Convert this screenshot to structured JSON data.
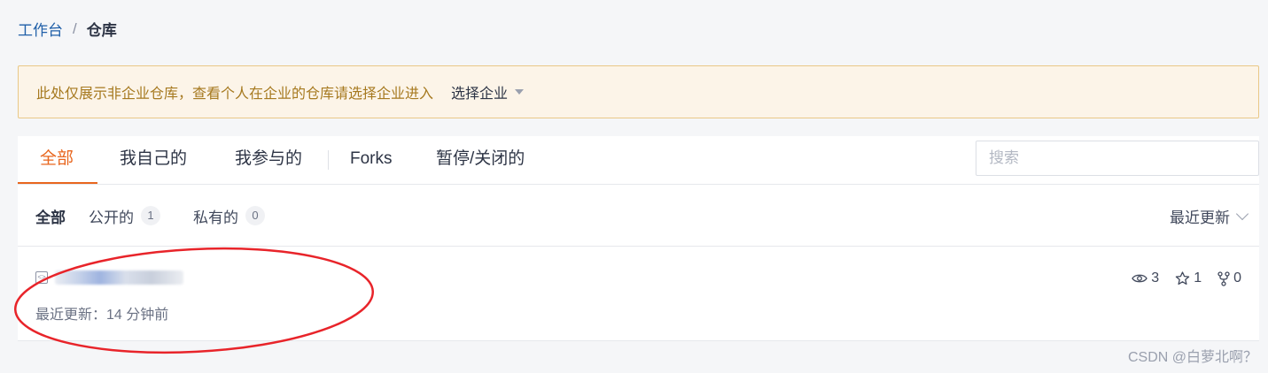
{
  "breadcrumb": {
    "home": "工作台",
    "separator": "/",
    "current": "仓库"
  },
  "notice": {
    "text": "此处仅展示非企业仓库，查看个人在企业的仓库请选择企业进入",
    "action": "选择企业"
  },
  "tabs": [
    {
      "label": "全部",
      "active": true
    },
    {
      "label": "我自己的"
    },
    {
      "label": "我参与的"
    },
    {
      "label": "Forks"
    },
    {
      "label": "暂停/关闭的"
    }
  ],
  "search": {
    "placeholder": "搜索",
    "value": ""
  },
  "filters": {
    "all": "全部",
    "public": {
      "label": "公开的",
      "count": "1"
    },
    "private": {
      "label": "私有的",
      "count": "0"
    }
  },
  "sort": {
    "label": "最近更新"
  },
  "repo": {
    "name": "",
    "updated": "最近更新：14 分钟前",
    "watchers": "3",
    "stars": "1",
    "forks": "0"
  },
  "watermark": "CSDN @白萝北啊？",
  "colors": {
    "accent": "#e8661e",
    "link": "#1f5fa8",
    "notice_bg": "#fcf4e8",
    "notice_border": "#e9c887",
    "annotation": "#e8242a"
  }
}
